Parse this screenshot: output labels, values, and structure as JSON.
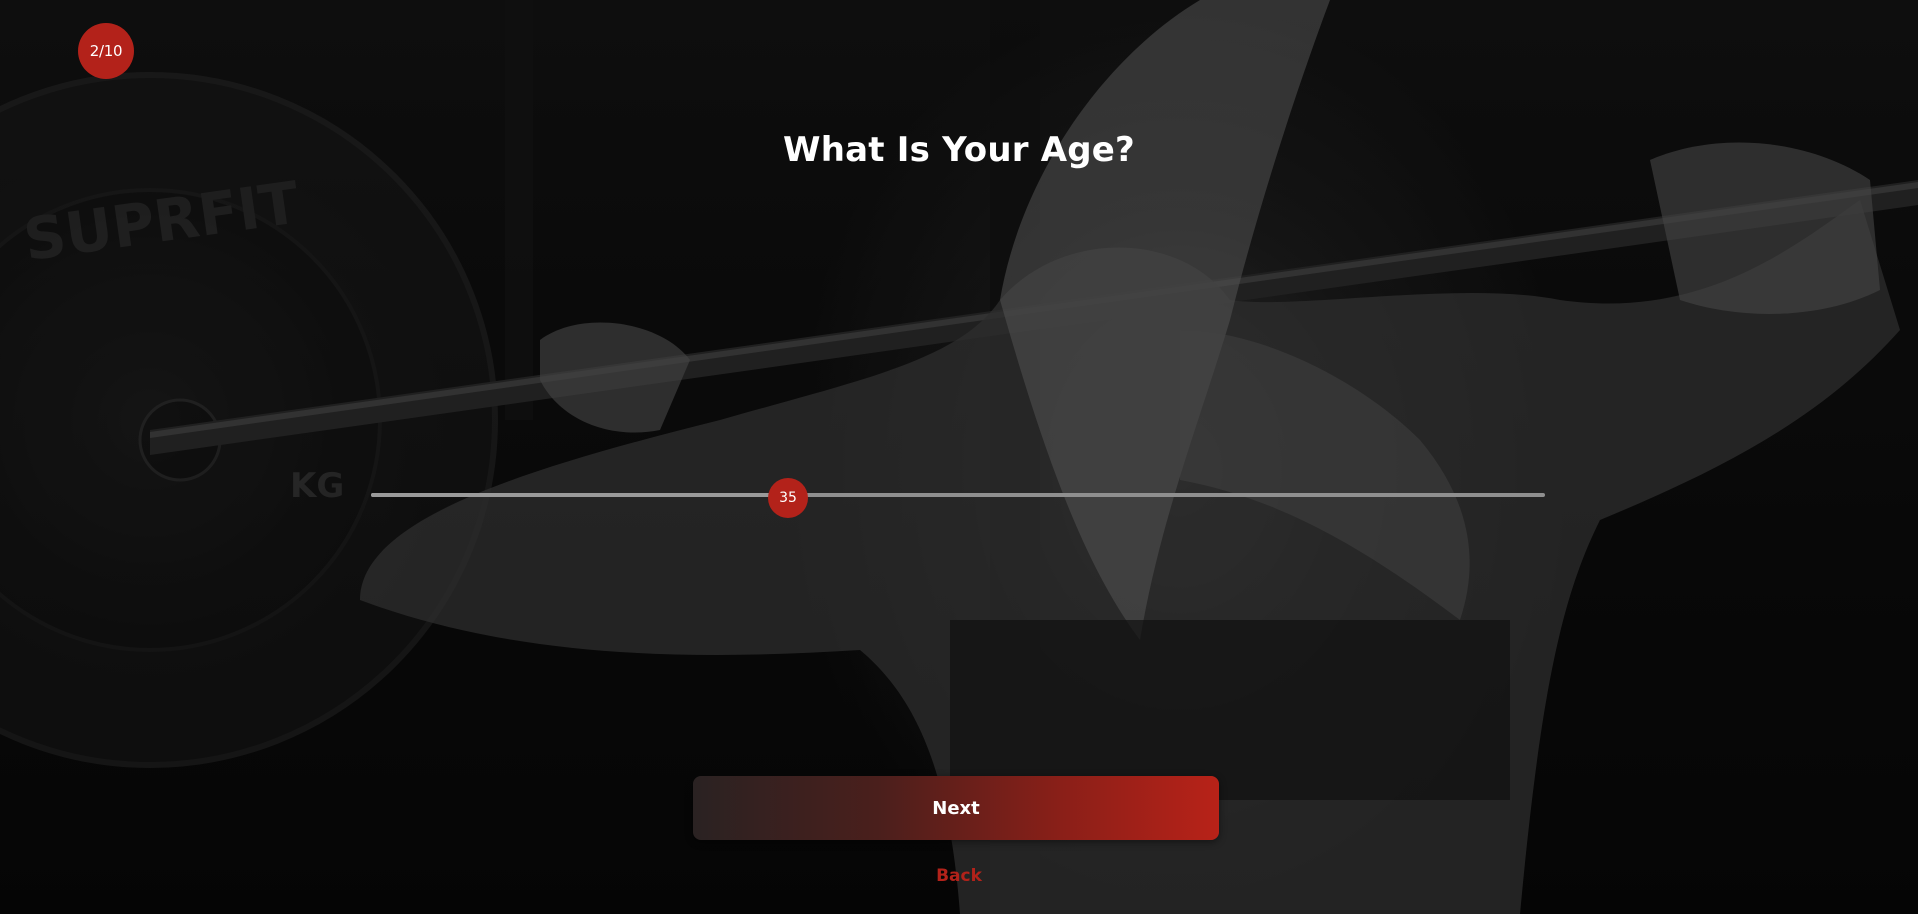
{
  "progress": {
    "label": "2/10",
    "current": 2,
    "total": 10
  },
  "question": {
    "title": "What Is Your Age?"
  },
  "age_slider": {
    "value_label": "35",
    "value": 35,
    "fraction": 0.355
  },
  "actions": {
    "next_label": "Next",
    "back_label": "Back"
  },
  "colors": {
    "accent": "#b3221a",
    "track": "#8f8f8f",
    "text": "#ffffff"
  },
  "background": {
    "description_icon": "gym-barbell-athlete-photo"
  }
}
